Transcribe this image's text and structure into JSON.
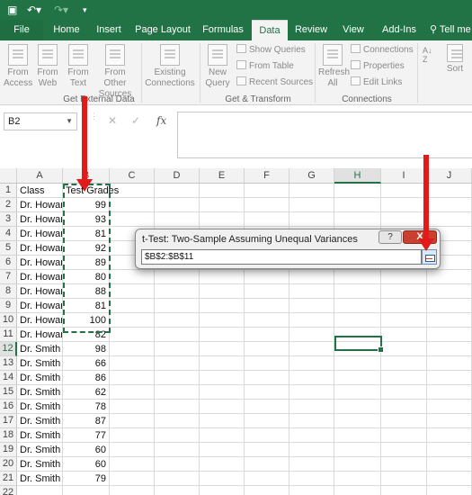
{
  "qat": {
    "save_icon": "save-icon",
    "undo_icon": "undo-icon",
    "redo_icon": "redo-icon"
  },
  "tabs": [
    {
      "label": "File"
    },
    {
      "label": "Home"
    },
    {
      "label": "Insert"
    },
    {
      "label": "Page Layout"
    },
    {
      "label": "Formulas"
    },
    {
      "label": "Data"
    },
    {
      "label": "Review"
    },
    {
      "label": "View"
    },
    {
      "label": "Add-Ins"
    },
    {
      "label": "Tell me"
    }
  ],
  "ribbon": {
    "from_access": "From Access",
    "from_web": "From Web",
    "from_text": "From Text",
    "from_other": "From Other Sources",
    "existing": "Existing Connections",
    "group1": "Get External Data",
    "new_query": "New Query",
    "show_queries": "Show Queries",
    "from_table": "From Table",
    "recent_sources": "Recent Sources",
    "group2": "Get & Transform",
    "refresh_all": "Refresh All",
    "connections": "Connections",
    "properties": "Properties",
    "edit_links": "Edit Links",
    "group3": "Connections",
    "sort": "Sort"
  },
  "formula_bar": {
    "name_box": "B2",
    "fx": "fx",
    "cancel": "✕",
    "enter": "✓",
    "formula": ""
  },
  "columns": [
    "A",
    "B",
    "C",
    "D",
    "E",
    "F",
    "G",
    "H",
    "I",
    "J"
  ],
  "rows": [
    {
      "n": "1",
      "a": "Class",
      "b": "Test Grades"
    },
    {
      "n": "2",
      "a": "Dr. Howard",
      "b": "99"
    },
    {
      "n": "3",
      "a": "Dr. Howard",
      "b": "93"
    },
    {
      "n": "4",
      "a": "Dr. Howard",
      "b": "81"
    },
    {
      "n": "5",
      "a": "Dr. Howard",
      "b": "92"
    },
    {
      "n": "6",
      "a": "Dr. Howard",
      "b": "89"
    },
    {
      "n": "7",
      "a": "Dr. Howard",
      "b": "80"
    },
    {
      "n": "8",
      "a": "Dr. Howard",
      "b": "88"
    },
    {
      "n": "9",
      "a": "Dr. Howard",
      "b": "81"
    },
    {
      "n": "10",
      "a": "Dr. Howard",
      "b": "100"
    },
    {
      "n": "11",
      "a": "Dr. Howard",
      "b": "82"
    },
    {
      "n": "12",
      "a": "Dr. Smith",
      "b": "98"
    },
    {
      "n": "13",
      "a": "Dr. Smith",
      "b": "66"
    },
    {
      "n": "14",
      "a": "Dr. Smith",
      "b": "86"
    },
    {
      "n": "15",
      "a": "Dr. Smith",
      "b": "62"
    },
    {
      "n": "16",
      "a": "Dr. Smith",
      "b": "78"
    },
    {
      "n": "17",
      "a": "Dr. Smith",
      "b": "87"
    },
    {
      "n": "18",
      "a": "Dr. Smith",
      "b": "77"
    },
    {
      "n": "19",
      "a": "Dr. Smith",
      "b": "60"
    },
    {
      "n": "20",
      "a": "Dr. Smith",
      "b": "60"
    },
    {
      "n": "21",
      "a": "Dr. Smith",
      "b": "79"
    },
    {
      "n": "22",
      "a": "",
      "b": ""
    }
  ],
  "dialog": {
    "title": "t-Test: Two-Sample Assuming Unequal Variances",
    "help": "?",
    "close": "X",
    "range_value": "$B$2:$B$11"
  },
  "colors": {
    "accent": "#217346",
    "arrow": "#e21a1a"
  }
}
